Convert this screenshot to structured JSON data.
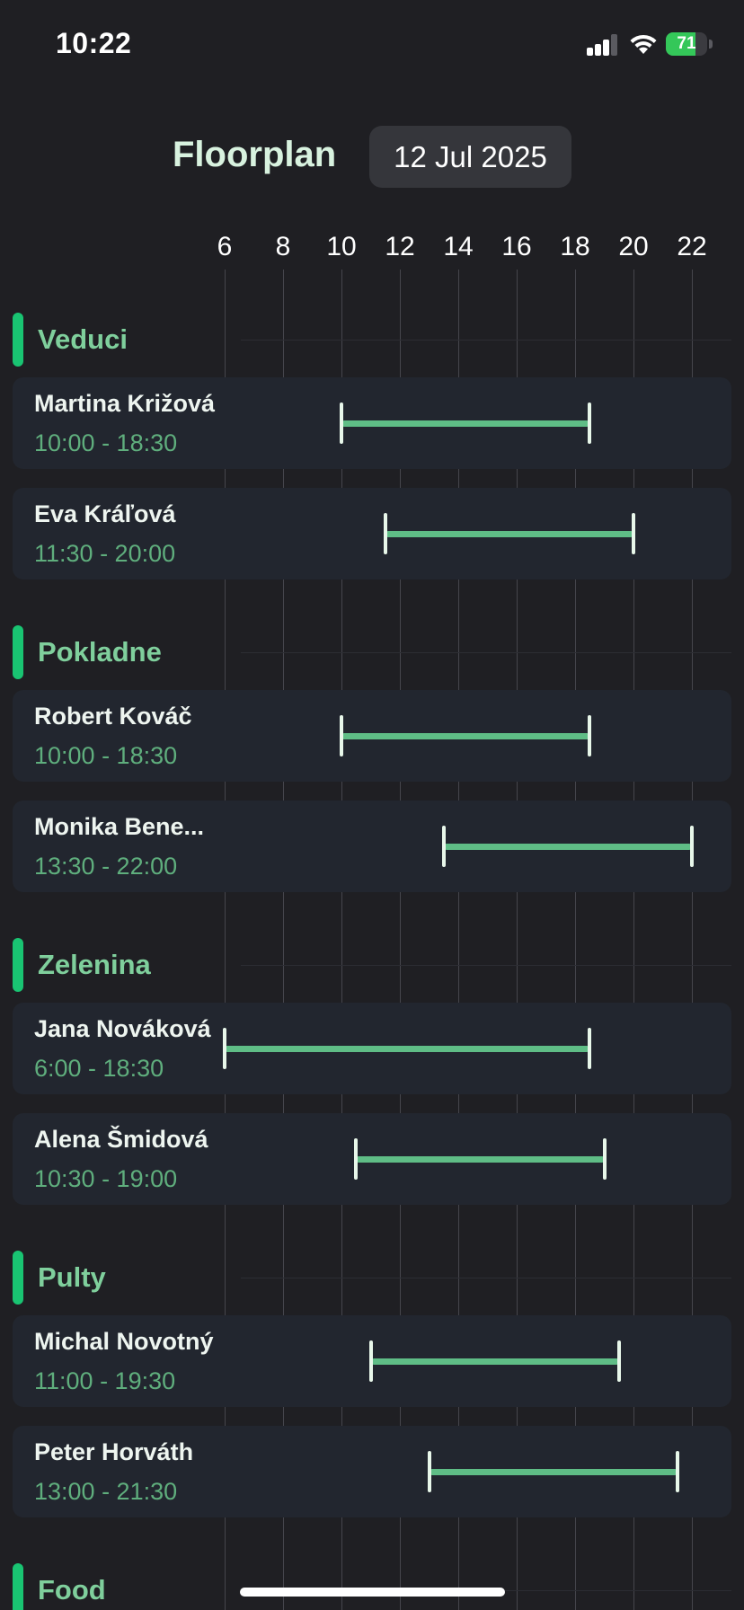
{
  "status": {
    "time": "10:22",
    "battery_percent": 71,
    "battery_label": "71"
  },
  "header": {
    "title": "Floorplan",
    "date": "12 Jul 2025"
  },
  "axis": {
    "hours": [
      "6",
      "8",
      "10",
      "12",
      "14",
      "16",
      "18",
      "20",
      "22"
    ]
  },
  "groups": [
    {
      "name": "Veduci",
      "people": [
        {
          "name": "Martina Križová",
          "time": "10:00 - 18:30",
          "start": 10.0,
          "end": 18.5
        },
        {
          "name": "Eva Kráľová",
          "time": "11:30 - 20:00",
          "start": 11.5,
          "end": 20.0
        }
      ]
    },
    {
      "name": "Pokladne",
      "people": [
        {
          "name": "Robert Kováč",
          "time": "10:00 - 18:30",
          "start": 10.0,
          "end": 18.5
        },
        {
          "name": "Monika Bene...",
          "time": "13:30 - 22:00",
          "start": 13.5,
          "end": 22.0
        }
      ]
    },
    {
      "name": "Zelenina",
      "people": [
        {
          "name": "Jana Nováková",
          "time": "6:00 - 18:30",
          "start": 6.0,
          "end": 18.5
        },
        {
          "name": "Alena Šmidová",
          "time": "10:30 - 19:00",
          "start": 10.5,
          "end": 19.0
        }
      ]
    },
    {
      "name": "Pulty",
      "people": [
        {
          "name": "Michal Novotný",
          "time": "11:00 - 19:30",
          "start": 11.0,
          "end": 19.5
        },
        {
          "name": "Peter Horváth",
          "time": "13:00 - 21:30",
          "start": 13.0,
          "end": 21.5
        }
      ]
    },
    {
      "name": "Food",
      "people": []
    }
  ],
  "colors": {
    "background": "#1f1f23",
    "card": "#22262f",
    "accent": "#19c472",
    "shift_bar": "#5fbd86",
    "group_title": "#7fcf9c",
    "shift_time": "#5fae7d"
  }
}
